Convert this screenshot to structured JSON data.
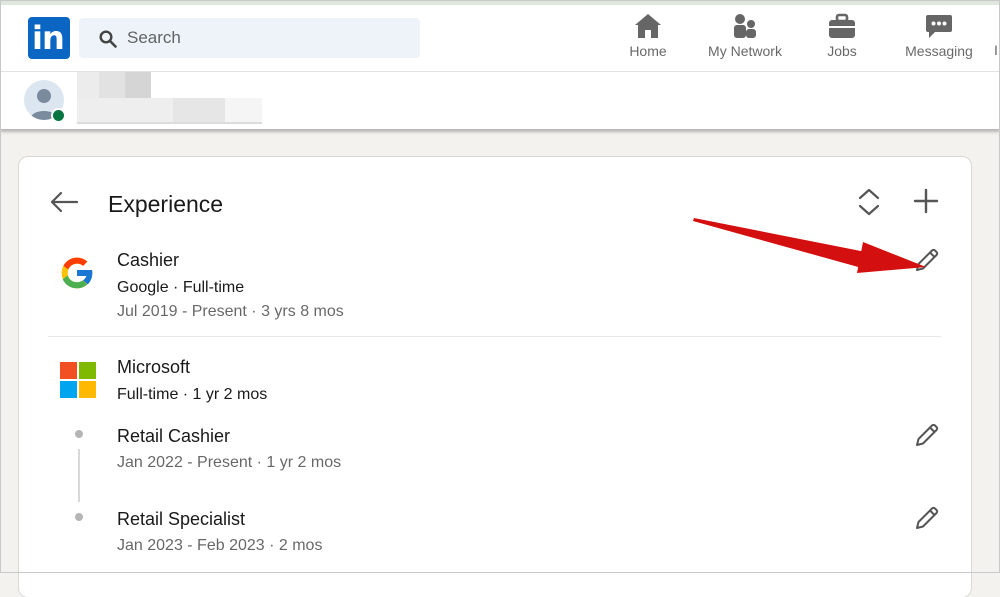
{
  "nav": {
    "logo_text": "in",
    "search": {
      "placeholder": "Search",
      "value": ""
    },
    "items": [
      {
        "label": "Home",
        "icon": "home-icon"
      },
      {
        "label": "My Network",
        "icon": "network-icon"
      },
      {
        "label": "Jobs",
        "icon": "briefcase-icon"
      },
      {
        "label": "Messaging",
        "icon": "messaging-icon"
      }
    ],
    "cut_label": "I"
  },
  "colors": {
    "brand": "#0a66c2",
    "presence": "#057642",
    "annotation_arrow": "#d40f0f"
  },
  "experience": {
    "title": "Experience",
    "entries": [
      {
        "company_icon": "google-logo-icon",
        "title": "Cashier",
        "subtitle": "Google · Full-time",
        "dates": "Jul 2019 - Present · 3 yrs 8 mos"
      },
      {
        "company_icon": "microsoft-logo-icon",
        "company": "Microsoft",
        "subtitle": "Full-time · 1 yr 2 mos",
        "positions": [
          {
            "title": "Retail Cashier",
            "dates": "Jan 2022 - Present · 1 yr 2 mos"
          },
          {
            "title": "Retail Specialist",
            "dates": "Jan 2023 - Feb 2023 · 2 mos"
          }
        ]
      }
    ]
  }
}
